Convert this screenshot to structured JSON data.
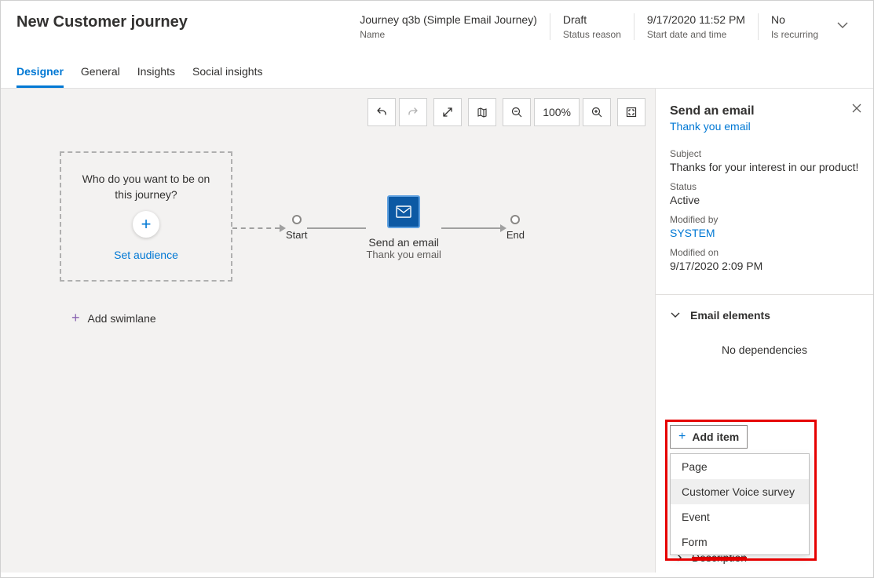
{
  "header": {
    "title": "New Customer journey",
    "meta": [
      {
        "value": "Journey q3b (Simple Email Journey)",
        "label": "Name"
      },
      {
        "value": "Draft",
        "label": "Status reason"
      },
      {
        "value": "9/17/2020 11:52 PM",
        "label": "Start date and time"
      },
      {
        "value": "No",
        "label": "Is recurring"
      }
    ]
  },
  "tabs": [
    "Designer",
    "General",
    "Insights",
    "Social insights"
  ],
  "toolbar": {
    "zoom": "100%"
  },
  "canvas": {
    "audience_question": "Who do you want to be on this journey?",
    "set_audience": "Set audience",
    "start_label": "Start",
    "end_label": "End",
    "email_title": "Send an email",
    "email_subtitle": "Thank you email",
    "add_swimlane": "Add swimlane"
  },
  "sidepanel": {
    "title": "Send an email",
    "link": "Thank you email",
    "subject_label": "Subject",
    "subject_value": "Thanks for your interest in our product!",
    "status_label": "Status",
    "status_value": "Active",
    "modifiedby_label": "Modified by",
    "modifiedby_value": "SYSTEM",
    "modifiedon_label": "Modified on",
    "modifiedon_value": "9/17/2020 2:09 PM",
    "elements_title": "Email elements",
    "no_deps": "No dependencies",
    "add_item": "Add item",
    "dropdown": [
      "Page",
      "Customer Voice survey",
      "Event",
      "Form"
    ],
    "description": "Description"
  }
}
